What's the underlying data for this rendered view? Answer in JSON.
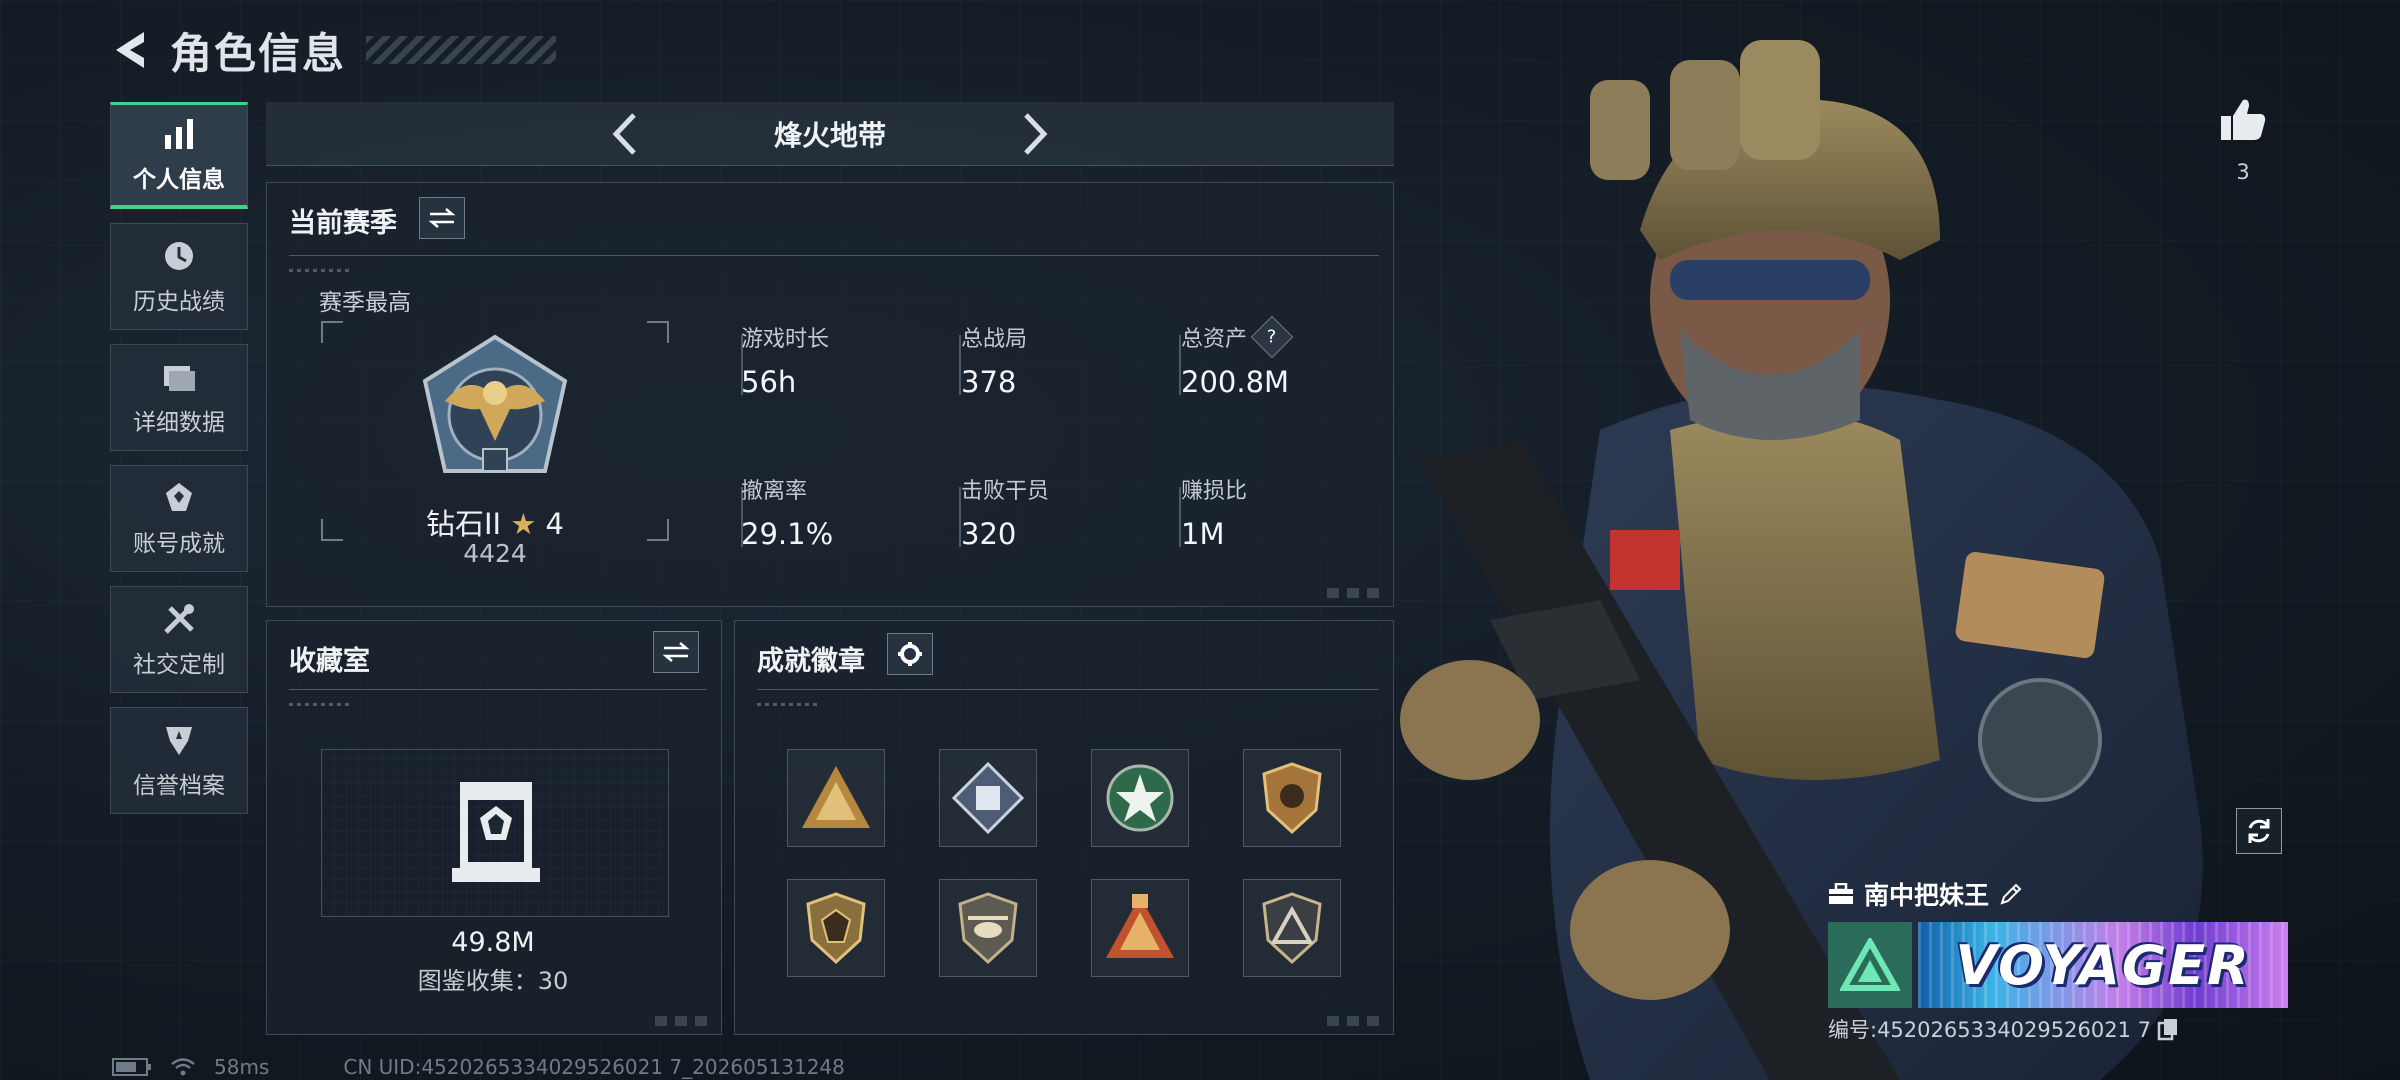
{
  "header": {
    "title": "角色信息"
  },
  "sidebar": {
    "items": [
      {
        "label": "个人信息",
        "icon": "bar-chart-icon"
      },
      {
        "label": "历史战绩",
        "icon": "history-icon"
      },
      {
        "label": "详细数据",
        "icon": "folder-icon"
      },
      {
        "label": "账号成就",
        "icon": "achievement-icon"
      },
      {
        "label": "社交定制",
        "icon": "tools-icon"
      },
      {
        "label": "信誉档案",
        "icon": "reputation-icon"
      }
    ],
    "active_index": 0
  },
  "mode": {
    "name": "烽火地带"
  },
  "season": {
    "title": "当前赛季",
    "best_label": "赛季最高",
    "rank_name": "钻石II",
    "rank_stars": "4",
    "rank_score": "4424",
    "stats": [
      {
        "label": "游戏时长",
        "value": "56h"
      },
      {
        "label": "总战局",
        "value": "378"
      },
      {
        "label": "总资产",
        "value": "200.8M",
        "has_help": true
      },
      {
        "label": "撤离率",
        "value": "29.1%"
      },
      {
        "label": "击败干员",
        "value": "320"
      },
      {
        "label": "赚损比",
        "value": "1M"
      }
    ],
    "help_glyph": "?"
  },
  "collection": {
    "title": "收藏室",
    "value": "49.8M",
    "count_text": "图鉴收集：30"
  },
  "badges": {
    "title": "成就徽章",
    "items": [
      {
        "icon": "triangle-squad-badge-icon"
      },
      {
        "icon": "diamond-crate-badge-icon"
      },
      {
        "icon": "green-star-badge-icon"
      },
      {
        "icon": "orange-shield-badge-icon"
      },
      {
        "icon": "gold-shield-badge-icon"
      },
      {
        "icon": "helicopter-badge-icon"
      },
      {
        "icon": "orange-triangle-badge-icon"
      },
      {
        "icon": "silver-triangle-badge-icon"
      }
    ]
  },
  "status": {
    "ping": "58ms",
    "uid": "CN UID:4520265334029526021 7_202605131248"
  },
  "profile": {
    "likes": "3",
    "player_name": "南中把妹王",
    "banner_text": "VOYAGER",
    "player_id": "编号:4520265334029526021 7"
  },
  "colors": {
    "accent": "#3fd28a",
    "panel_bg": "#1a232d",
    "tier_green": "#2b6b5a"
  }
}
